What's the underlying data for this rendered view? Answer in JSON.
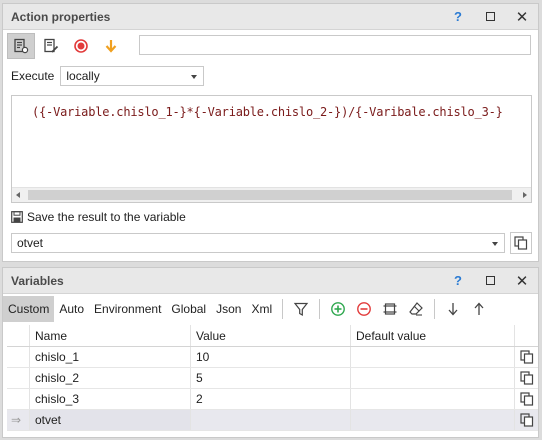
{
  "action_panel": {
    "title": "Action properties",
    "help": "?",
    "execute_label": "Execute",
    "execute_value": "locally",
    "expression": "({-Variable.chislo_1-}*{-Variable.chislo_2-})/{-Varibale.chislo_3-}",
    "save_label": "Save the result to the variable",
    "result_variable": "otvet"
  },
  "variables_panel": {
    "title": "Variables",
    "help": "?",
    "tabs": [
      "Custom",
      "Auto",
      "Environment",
      "Global",
      "Json",
      "Xml"
    ],
    "columns": [
      "Name",
      "Value",
      "Default value"
    ],
    "rows": [
      {
        "marker": "",
        "name": "chislo_1",
        "value": "10",
        "default": ""
      },
      {
        "marker": "",
        "name": "chislo_2",
        "value": "5",
        "default": ""
      },
      {
        "marker": "",
        "name": "chislo_3",
        "value": "2",
        "default": ""
      },
      {
        "marker": "⇒",
        "name": "otvet",
        "value": "",
        "default": ""
      }
    ]
  },
  "colors": {
    "help_accent": "#2b7bd3",
    "record_red": "#e23b3b",
    "arrow_orange": "#f0a020",
    "add_green": "#2fa84f",
    "expression_text": "#7a1a1a"
  }
}
